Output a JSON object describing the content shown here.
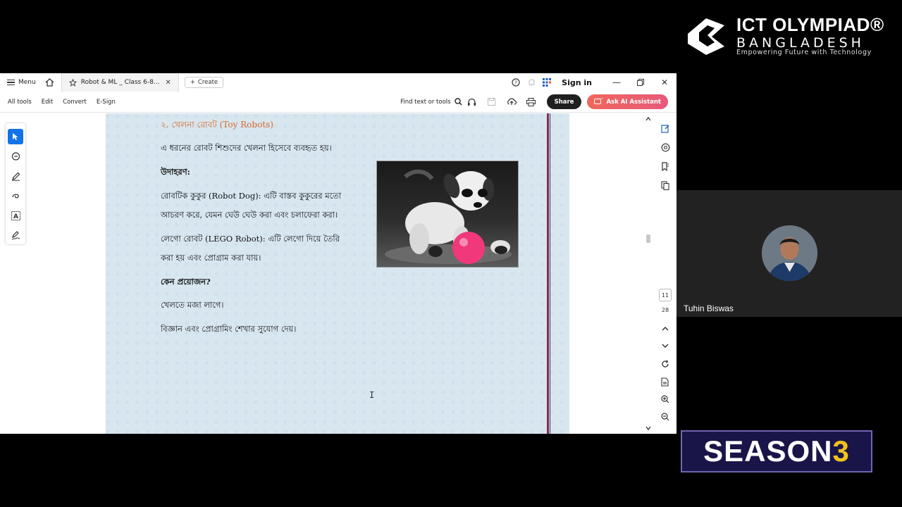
{
  "titlebar": {
    "menu_label": "Menu",
    "tab_title": "Robot & ML _ Class 6-8...",
    "create_label": "Create",
    "signin_label": "Sign in"
  },
  "toolbar": {
    "all_tools": "All tools",
    "edit": "Edit",
    "convert": "Convert",
    "esign": "E-Sign",
    "find_label": "Find text or tools",
    "share_label": "Share",
    "ai_label": "Ask AI Assistant"
  },
  "document": {
    "heading": "২. খেলনা রোবট (Toy Robots)",
    "intro": "এ ধরনের রোবট শিশুদের খেলনা হিসেবে ব্যবহৃত হয়।",
    "examples_label": "উদাহরণ:",
    "robot_dog_1": "রোবটিক কুকুর (Robot Dog): এটি বাস্তব কুকুরের মতো",
    "robot_dog_2": "আচরণ করে, যেমন ঘেউ ঘেউ করা এবং চলাফেরা করা।",
    "lego_1": "লেগো রোবট (LEGO Robot): এটি লেগো দিয়ে তৈরি",
    "lego_2": "করা হয় এবং প্রোগ্রাম করা যায়।",
    "why_label": "কেন প্রয়োজন?",
    "why_1": "খেলতে মজা লাগে।",
    "why_2": "বিজ্ঞান এবং প্রোগ্রামিং শেখার সুযোগ দেয়।"
  },
  "pager": {
    "current_page": "11",
    "total_pages": "28"
  },
  "overlay": {
    "logo_title": "ICT OLYMPIAD®",
    "logo_subtitle": "BANGLADESH",
    "logo_tagline": "Empowering Future with Technology",
    "presenter_name": "Tuhin Biswas",
    "season_word": "SEASON",
    "season_number": "3"
  }
}
